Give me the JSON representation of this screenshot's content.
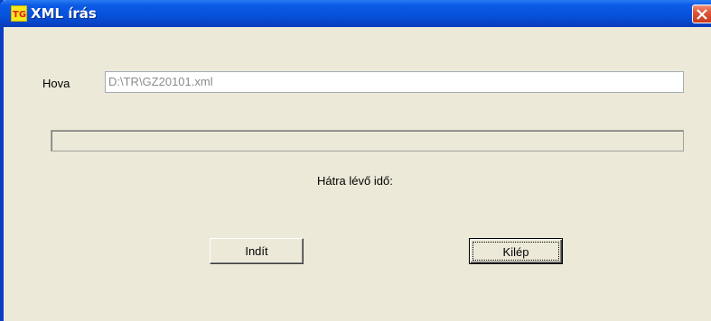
{
  "window": {
    "title": "XML írás",
    "icon": "tg-app-icon",
    "close_icon": "close-icon"
  },
  "form": {
    "destination_label": "Hova",
    "destination_value": "D:\\TR\\GZ20101.xml"
  },
  "progress": {
    "fraction": 0
  },
  "status": {
    "time_left_label": "Hátra lévő idő:"
  },
  "buttons": {
    "start_label": "Indít",
    "exit_label": "Kilép"
  },
  "colors": {
    "titlebar": "#0652dc",
    "window_bg": "#ece9d8",
    "close_button": "#e0543a"
  }
}
